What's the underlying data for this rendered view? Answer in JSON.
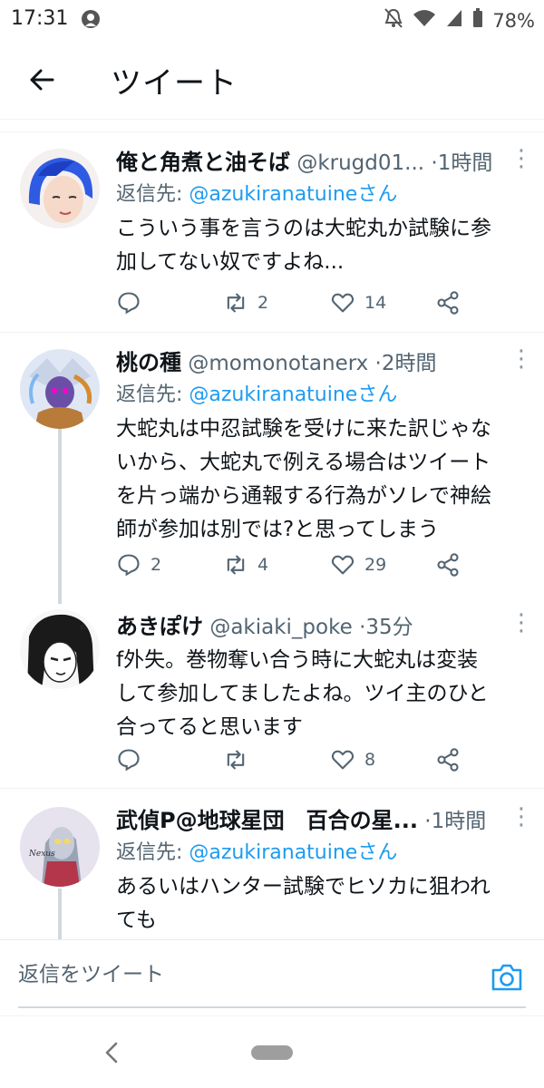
{
  "status_bar": {
    "time": "17:31",
    "battery": "78%",
    "icons": [
      "app-notification-icon",
      "notifications-off-icon",
      "wifi-icon",
      "signal-icon",
      "battery-icon"
    ]
  },
  "header": {
    "title": "ツイート",
    "back_icon": "arrow-left-icon"
  },
  "colors": {
    "link": "#1d9bf0",
    "secondary_text": "#536471",
    "primary_text": "#0f1419",
    "divider": "#eff3f4"
  },
  "tweets": [
    {
      "name": "俺と角煮と油そば",
      "handle": "@krugd01...",
      "time": "1時間",
      "reply_prefix": "返信先: ",
      "reply_mention": "@azukiranatuineさん",
      "text_lines": [
        "こういう事を言うのは大蛇丸か試験に参",
        "加してない奴ですよね..."
      ],
      "replies": "",
      "retweets": "2",
      "likes": "14"
    },
    {
      "name": "桃の種",
      "handle": "@momonotanerx",
      "time": "2時間",
      "reply_prefix": "返信先: ",
      "reply_mention": "@azukiranatuineさん",
      "text_lines": [
        "大蛇丸は中忍試験を受けに来た訳じゃな",
        "いから、大蛇丸で例える場合はツイート",
        "を片っ端から通報する行為がソレで神絵",
        "師が参加は別では?と思ってしまう"
      ],
      "replies": "2",
      "retweets": "4",
      "likes": "29"
    },
    {
      "name": "あきぽけ",
      "handle": "@akiaki_poke",
      "time": "35分",
      "text_lines": [
        "f外失。巻物奪い合う時に大蛇丸は変装",
        "して参加してましたよね。ツイ主のひと",
        "合ってると思います"
      ],
      "replies": "",
      "retweets": "",
      "likes": "8"
    },
    {
      "name": "武偵P@地球星団　百合の星...",
      "handle": "",
      "time": "1時間",
      "reply_prefix": "返信先: ",
      "reply_mention": "@azukiranatuineさん",
      "text_lines": [
        "あるいはハンター試験でヒソカに狙われ",
        "ても"
      ]
    }
  ],
  "separator": "·",
  "compose": {
    "placeholder": "返信をツイート",
    "camera_icon": "camera-icon"
  },
  "nav_bar": {
    "back_icon": "nav-back-icon",
    "home_icon": "home-pill-icon"
  }
}
